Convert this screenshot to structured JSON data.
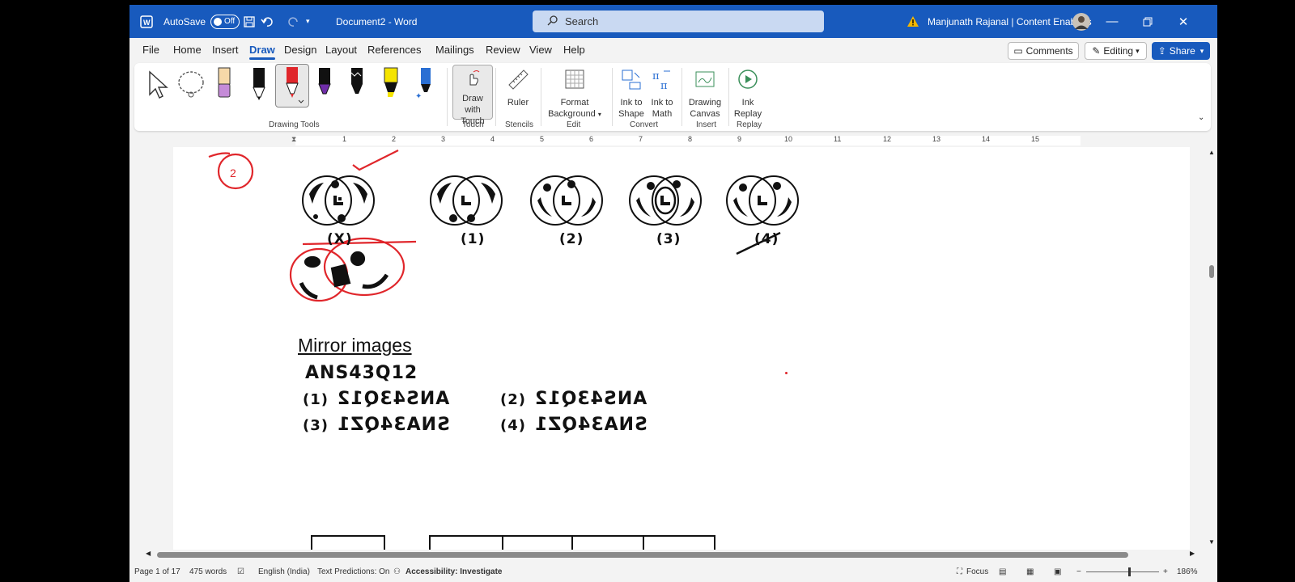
{
  "titlebar": {
    "autosave_label": "AutoSave",
    "autosave_state": "Off",
    "document_title": "Document2  -  Word",
    "search_placeholder": "Search",
    "user_name": "Manjunath Rajanal | Content Enablers"
  },
  "tabs": [
    "File",
    "Home",
    "Insert",
    "Draw",
    "Design",
    "Layout",
    "References",
    "Mailings",
    "Review",
    "View",
    "Help"
  ],
  "active_tab": "Draw",
  "top_buttons": {
    "comments": "Comments",
    "editing": "Editing",
    "share": "Share"
  },
  "ribbon": {
    "groups": [
      "Drawing Tools",
      "Touch",
      "Stencils",
      "Edit",
      "Convert",
      "Insert",
      "Replay"
    ],
    "draw_with_touch": "Draw with Touch",
    "ruler": "Ruler",
    "format_background": "Format Background",
    "ink_to_shape": "Ink to Shape",
    "ink_to_math": "Ink to Math",
    "drawing_canvas": "Drawing Canvas",
    "ink_replay": "Ink Replay"
  },
  "ruler_numbers": [
    "1",
    "2",
    "3",
    "4",
    "5",
    "6",
    "7",
    "8",
    "9",
    "10",
    "11",
    "12",
    "13",
    "14",
    "15"
  ],
  "document": {
    "figure_labels": [
      "(X)",
      "(1)",
      "(2)",
      "(3)",
      "(4)"
    ],
    "heading": "Mirror  images",
    "question": "ANS43Q12",
    "options": [
      {
        "num": "(1)",
        "text": "ANS43Q12",
        "flip": "h"
      },
      {
        "num": "(2)",
        "text": "ANS43Q12",
        "flip": "h-rev"
      },
      {
        "num": "(3)",
        "text": "SNA34QZ1",
        "flip": "h"
      },
      {
        "num": "(4)",
        "text": "SNA34QZ1",
        "flip": "h-rev"
      }
    ],
    "annotation_number": "2"
  },
  "statusbar": {
    "page": "Page 1 of 17",
    "words": "475 words",
    "language": "English (India)",
    "predictions": "Text Predictions: On",
    "accessibility": "Accessibility: Investigate",
    "focus": "Focus",
    "zoom": "186%"
  },
  "colors": {
    "accent": "#185abd",
    "ink_red": "#e0262b"
  }
}
